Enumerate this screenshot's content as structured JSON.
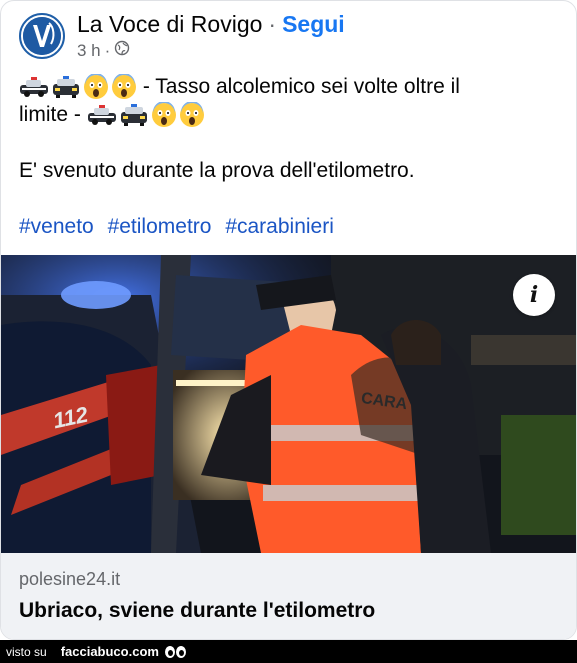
{
  "post": {
    "page_name": "La Voce di Rovigo",
    "separator": "·",
    "follow_label": "Segui",
    "time": "3 h",
    "time_separator": "·",
    "visibility_icon": "globe-icon",
    "line1_text": "- Tasso alcolemico sei volte oltre il",
    "line2_text": "limite -",
    "paragraph2": "E' svenuto durante la prova dell'etilometro.",
    "hashtags": [
      "#veneto",
      "#etilometro",
      "#carabinieri"
    ]
  },
  "emojis": {
    "car1": "police-car-icon",
    "car2": "oncoming-police-car-icon",
    "scream": "face-screaming-in-fear-icon"
  },
  "photo": {
    "car_number": "112",
    "vest_text": "CARA",
    "info_label": "i"
  },
  "link": {
    "domain": "polesine24.it",
    "title": "Ubriaco, sviene durante l'etilometro"
  },
  "footer": {
    "visto": "visto su",
    "brand": "facciabuco.com"
  },
  "colors": {
    "link_blue": "#1877f2",
    "hashtag_blue": "#1b55c4",
    "muted": "#65676b",
    "link_bg": "#f0f2f5"
  }
}
